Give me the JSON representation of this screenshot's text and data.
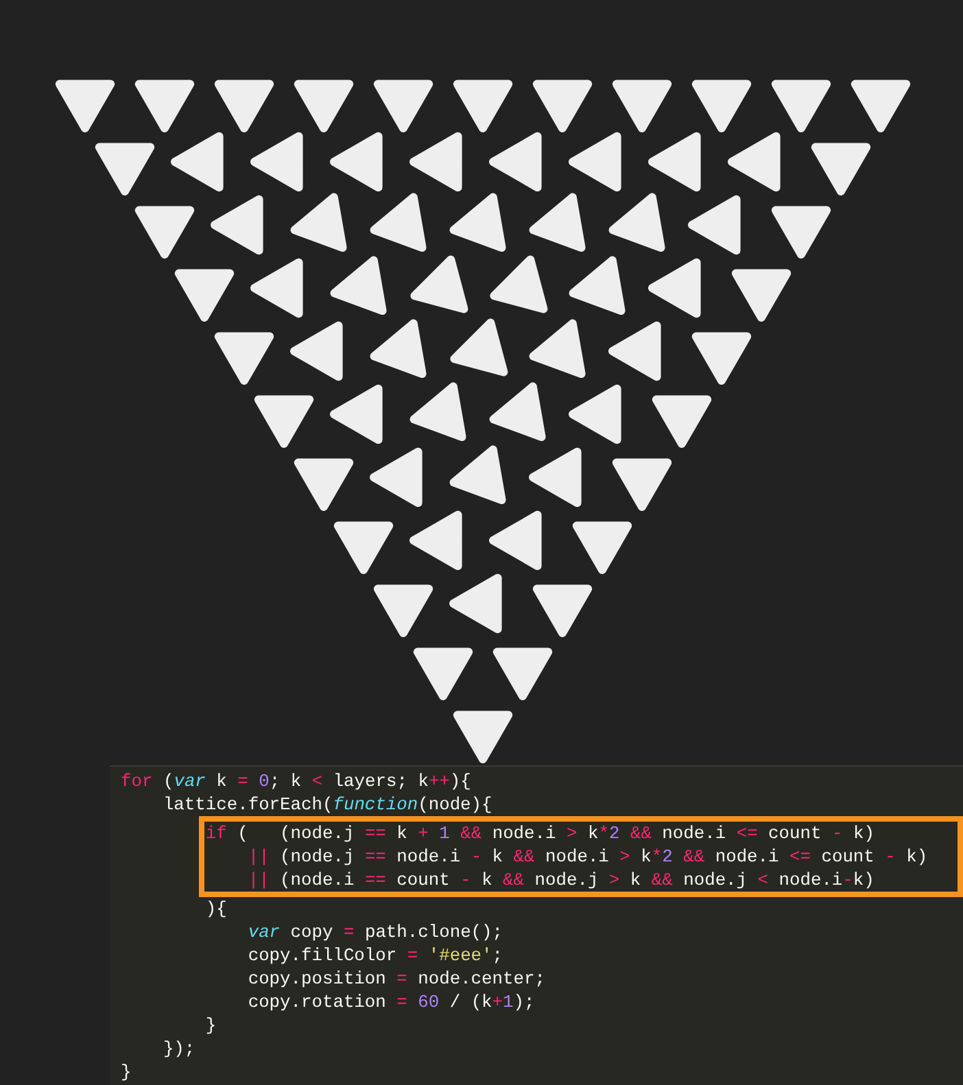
{
  "editor": {
    "lines": [
      {
        "highlighted": false,
        "tokens": [
          {
            "text": "for",
            "kind": "keyword"
          },
          {
            "text": " (",
            "kind": "plain"
          },
          {
            "text": "var",
            "kind": "storage"
          },
          {
            "text": " k ",
            "kind": "plain"
          },
          {
            "text": "=",
            "kind": "keyword"
          },
          {
            "text": " 0",
            "kind": "number"
          },
          {
            "text": "; k ",
            "kind": "plain"
          },
          {
            "text": "<",
            "kind": "keyword"
          },
          {
            "text": " layers; k",
            "kind": "plain"
          },
          {
            "text": "++",
            "kind": "keyword"
          },
          {
            "text": "){",
            "kind": "plain"
          }
        ]
      },
      {
        "highlighted": false,
        "tokens": [
          {
            "text": "    lattice.forEach(",
            "kind": "plain"
          },
          {
            "text": "function",
            "kind": "storage"
          },
          {
            "text": "(node){",
            "kind": "plain"
          }
        ]
      },
      {
        "highlighted": true,
        "tokens": [
          {
            "text": "        if",
            "kind": "keyword"
          },
          {
            "text": " (   (node.j ",
            "kind": "plain"
          },
          {
            "text": "==",
            "kind": "keyword"
          },
          {
            "text": " k ",
            "kind": "plain"
          },
          {
            "text": "+",
            "kind": "keyword"
          },
          {
            "text": " 1",
            "kind": "number"
          },
          {
            "text": " &&",
            "kind": "keyword"
          },
          {
            "text": " node.i ",
            "kind": "plain"
          },
          {
            "text": ">",
            "kind": "keyword"
          },
          {
            "text": " k",
            "kind": "plain"
          },
          {
            "text": "*",
            "kind": "keyword"
          },
          {
            "text": "2",
            "kind": "number"
          },
          {
            "text": " &&",
            "kind": "keyword"
          },
          {
            "text": " node.i ",
            "kind": "plain"
          },
          {
            "text": "<=",
            "kind": "keyword"
          },
          {
            "text": " count ",
            "kind": "plain"
          },
          {
            "text": "-",
            "kind": "keyword"
          },
          {
            "text": " k)",
            "kind": "plain"
          }
        ]
      },
      {
        "highlighted": true,
        "tokens": [
          {
            "text": "            ||",
            "kind": "keyword"
          },
          {
            "text": " (node.j ",
            "kind": "plain"
          },
          {
            "text": "==",
            "kind": "keyword"
          },
          {
            "text": " node.i ",
            "kind": "plain"
          },
          {
            "text": "-",
            "kind": "keyword"
          },
          {
            "text": " k ",
            "kind": "plain"
          },
          {
            "text": "&&",
            "kind": "keyword"
          },
          {
            "text": " node.i ",
            "kind": "plain"
          },
          {
            "text": ">",
            "kind": "keyword"
          },
          {
            "text": " k",
            "kind": "plain"
          },
          {
            "text": "*",
            "kind": "keyword"
          },
          {
            "text": "2",
            "kind": "number"
          },
          {
            "text": " &&",
            "kind": "keyword"
          },
          {
            "text": " node.i ",
            "kind": "plain"
          },
          {
            "text": "<=",
            "kind": "keyword"
          },
          {
            "text": " count ",
            "kind": "plain"
          },
          {
            "text": "-",
            "kind": "keyword"
          },
          {
            "text": " k)",
            "kind": "plain"
          }
        ]
      },
      {
        "highlighted": true,
        "tokens": [
          {
            "text": "            ||",
            "kind": "keyword"
          },
          {
            "text": " (node.i ",
            "kind": "plain"
          },
          {
            "text": "==",
            "kind": "keyword"
          },
          {
            "text": " count ",
            "kind": "plain"
          },
          {
            "text": "-",
            "kind": "keyword"
          },
          {
            "text": " k ",
            "kind": "plain"
          },
          {
            "text": "&&",
            "kind": "keyword"
          },
          {
            "text": " node.j ",
            "kind": "plain"
          },
          {
            "text": ">",
            "kind": "keyword"
          },
          {
            "text": " k ",
            "kind": "plain"
          },
          {
            "text": "&&",
            "kind": "keyword"
          },
          {
            "text": " node.j ",
            "kind": "plain"
          },
          {
            "text": "<",
            "kind": "keyword"
          },
          {
            "text": " node.i",
            "kind": "plain"
          },
          {
            "text": "-",
            "kind": "keyword"
          },
          {
            "text": "k)",
            "kind": "plain"
          }
        ]
      },
      {
        "highlighted": false,
        "tokens": [
          {
            "text": "        ){",
            "kind": "plain"
          }
        ]
      },
      {
        "highlighted": false,
        "tokens": [
          {
            "text": "            var",
            "kind": "storage"
          },
          {
            "text": " copy ",
            "kind": "plain"
          },
          {
            "text": "=",
            "kind": "keyword"
          },
          {
            "text": " path.clone();",
            "kind": "plain"
          }
        ]
      },
      {
        "highlighted": false,
        "tokens": [
          {
            "text": "            copy.fillColor ",
            "kind": "plain"
          },
          {
            "text": "=",
            "kind": "keyword"
          },
          {
            "text": " '#eee'",
            "kind": "string"
          },
          {
            "text": ";",
            "kind": "plain"
          }
        ]
      },
      {
        "highlighted": false,
        "tokens": [
          {
            "text": "            copy.position ",
            "kind": "plain"
          },
          {
            "text": "=",
            "kind": "keyword"
          },
          {
            "text": " node.center;",
            "kind": "plain"
          }
        ]
      },
      {
        "highlighted": false,
        "tokens": [
          {
            "text": "            copy.rotation ",
            "kind": "plain"
          },
          {
            "text": "=",
            "kind": "keyword"
          },
          {
            "text": " 60",
            "kind": "number"
          },
          {
            "text": " / (k",
            "kind": "plain"
          },
          {
            "text": "+",
            "kind": "keyword"
          },
          {
            "text": "1",
            "kind": "number"
          },
          {
            "text": ");",
            "kind": "plain"
          }
        ]
      },
      {
        "highlighted": false,
        "tokens": [
          {
            "text": "        }",
            "kind": "plain"
          }
        ]
      },
      {
        "highlighted": false,
        "tokens": [
          {
            "text": "    });",
            "kind": "plain"
          }
        ]
      },
      {
        "highlighted": false,
        "tokens": [
          {
            "text": "}",
            "kind": "plain"
          }
        ]
      }
    ]
  }
}
